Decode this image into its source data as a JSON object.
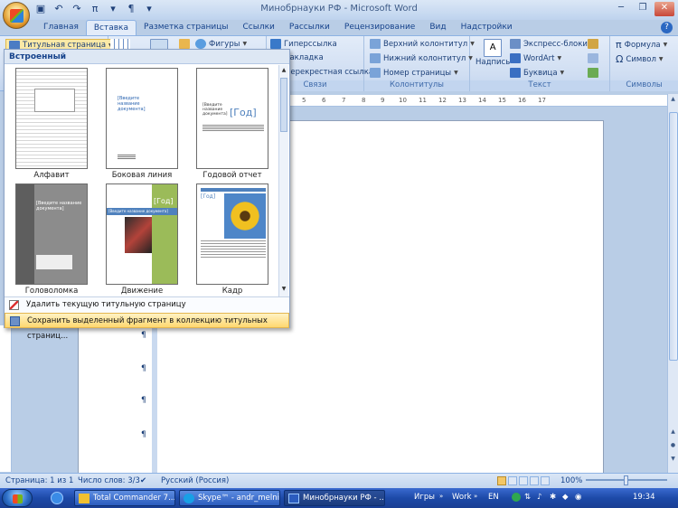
{
  "window": {
    "title": "Минобрнауки РФ - Microsoft Word"
  },
  "tabs": [
    "Главная",
    "Вставка",
    "Разметка страницы",
    "Ссылки",
    "Рассылки",
    "Рецензирование",
    "Вид",
    "Надстройки"
  ],
  "active_tab": "Вставка",
  "ribbon": {
    "cover_page_btn": "Титульная страница",
    "shapes_btn": "Фигуры",
    "links": {
      "hyperlink": "Гиперссылка",
      "bookmark": "Закладка",
      "crossref": "Перекрестная ссылка",
      "group_label": "Связи"
    },
    "header_footer": {
      "header": "Верхний колонтитул",
      "footer": "Нижний колонтитул",
      "page_number": "Номер страницы",
      "group_label": "Колонтитулы"
    },
    "text": {
      "textbox": "Надпись",
      "quickparts": "Экспресс-блоки",
      "wordart": "WordArt",
      "dropcap": "Буквица",
      "group_label": "Текст"
    },
    "symbols": {
      "formula": "Формула",
      "symbol": "Символ",
      "group_label": "Символы"
    }
  },
  "ruler": {
    "ticks": [
      "5",
      "6",
      "7",
      "8",
      "9",
      "10",
      "11",
      "12",
      "13",
      "14",
      "15",
      "16",
      "17"
    ]
  },
  "dropdown": {
    "header": "Встроенный",
    "thumbnails": [
      {
        "label": "Алфавит"
      },
      {
        "label": "Боковая линия",
        "text1": "[Введите название документа]"
      },
      {
        "label": "Годовой отчет",
        "text1": "[Введите название документа]",
        "text2": "[Год]"
      },
      {
        "label": "Головоломка",
        "text1": "[Введите название документа]"
      },
      {
        "label": "Движение",
        "text1": "[Год]",
        "text2": "[Введите название документа]"
      },
      {
        "label": "Кадр",
        "text1": "[Год]"
      }
    ],
    "commands": [
      {
        "label": "Удалить текущую титульную страницу"
      },
      {
        "label": "Сохранить выделенный фрагмент в коллекцию титульных страниц..."
      }
    ]
  },
  "statusbar": {
    "page": "Страница: 1 из 1",
    "words": "Число слов: 3/3",
    "language": "Русский (Россия)",
    "zoom": "100%"
  },
  "taskbar": {
    "items": [
      {
        "label": "Total Commander 7...."
      },
      {
        "label": "Skype™ - andr_melnik"
      },
      {
        "label": "Минобрнауки РФ - ..."
      }
    ],
    "tray": {
      "games": "Игры",
      "work": "Work",
      "lang": "EN",
      "clock": "19:34"
    }
  },
  "colors": {
    "ribbon_bg": "#d0def2",
    "doc_bg": "#b9cde6",
    "hover": "#ffd76f",
    "taskbar": "#1d4aa8"
  }
}
